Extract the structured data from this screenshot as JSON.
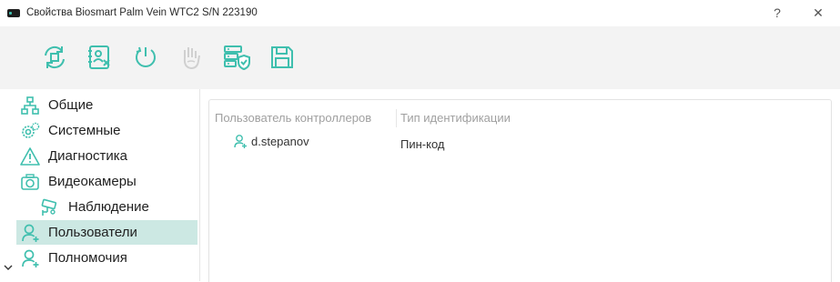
{
  "window": {
    "title": "Свойства Biosmart Palm Vein WTC2 S/N 223190",
    "help_glyph": "?",
    "close_glyph": "✕"
  },
  "colors": {
    "accent": "#3fbfae",
    "selected_bg": "#cce8e3",
    "toolbar_bg": "#f3f3f3",
    "disabled_icon": "#d0d0d0"
  },
  "toolbar": {
    "buttons": [
      {
        "icon": "sync-chip-icon"
      },
      {
        "icon": "user-card-remove-icon"
      },
      {
        "icon": "power-restart-icon"
      },
      {
        "icon": "palm-scan-icon",
        "disabled": true
      },
      {
        "icon": "server-shield-icon"
      },
      {
        "icon": "save-icon"
      }
    ]
  },
  "sidebar": {
    "items": [
      {
        "label": "Общие",
        "icon": "network-hierarchy-icon"
      },
      {
        "label": "Системные",
        "icon": "gears-icon"
      },
      {
        "label": "Диагностика",
        "icon": "warning-icon"
      },
      {
        "label": "Видеокамеры",
        "icon": "camera-icon",
        "expanded": true
      },
      {
        "label": "Наблюдение",
        "icon": "cctv-icon"
      },
      {
        "label": "Пользователи",
        "icon": "user-add-icon",
        "selected": true
      },
      {
        "label": "Полномочия",
        "icon": "user-add-icon"
      }
    ]
  },
  "table": {
    "columns": [
      "Пользователь контроллеров",
      "Тип идентификации"
    ],
    "rows": [
      {
        "user": "d.stepanov",
        "id_type": "Пин-код"
      }
    ]
  }
}
